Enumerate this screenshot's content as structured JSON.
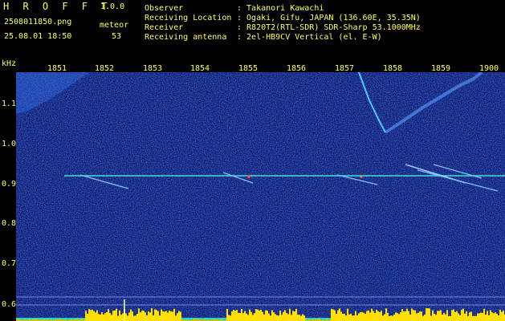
{
  "app": {
    "name": "H R O F F T",
    "version": "1.0.0"
  },
  "file": {
    "name": "2508011850.png",
    "datetime": "25.08.01 18:50"
  },
  "meteor": {
    "label": "meteor",
    "count": "53"
  },
  "info": [
    {
      "label": "Observer",
      "value": ": Takanori Kawachi"
    },
    {
      "label": "Receiving Location",
      "value": ": Ogaki, Gifu, JAPAN (136.60E, 35.35N)"
    },
    {
      "label": "Receiver",
      "value": ": R820T2(RTL-SDR) SDR-Sharp 53.1000MHz"
    },
    {
      "label": "Receiving antenna",
      "value": ": 2el-HB9CV Vertical (el. E-W)"
    }
  ],
  "axis": {
    "unit": "kHz",
    "time_ticks": [
      "1851",
      "1852",
      "1853",
      "1854",
      "1855",
      "1856",
      "1857",
      "1858",
      "1859",
      "1900"
    ],
    "freq_ticks": [
      "1.1",
      "1.0",
      "0.9",
      "0.8",
      "0.7",
      "0.6"
    ]
  },
  "colors": {
    "background": "#000000",
    "text": "#ffff55",
    "noise": "#0a1a80",
    "carrier": "#40e0d0",
    "echo": "#80c0ff",
    "level": "#ffe000"
  }
}
